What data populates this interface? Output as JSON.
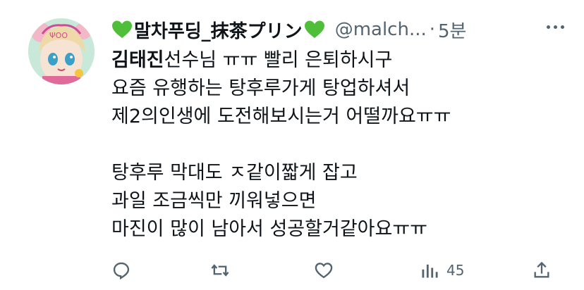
{
  "tweet": {
    "display_name": "말차푸딩_抹茶プリン",
    "handle": "@malch...",
    "separator": "·",
    "time": "5분",
    "lines": [
      {
        "mention": "김태진",
        "text": "선수님 ㅠㅠ 빨리 은퇴하시구"
      },
      {
        "mention": "",
        "text": "요즘 유행하는 탕후루가게 탕업하셔서"
      },
      {
        "mention": "",
        "text": "제2의인생에 도전해보시는거 어떨까요ㅠㅠ"
      },
      {
        "mention": "",
        "text": ""
      },
      {
        "mention": "",
        "text": "탕후루 막대도 ㅈ같이짧게 잡고"
      },
      {
        "mention": "",
        "text": "과일 조금씩만 끼워넣으면"
      },
      {
        "mention": "",
        "text": "마진이 많이 남아서 성공할거같아요ㅠㅠ"
      }
    ]
  },
  "actions": {
    "views_count": "45"
  },
  "icons": {
    "heart_emoji": "green-heart-icon",
    "reply": "reply-icon",
    "retweet": "retweet-icon",
    "like": "like-icon",
    "views": "views-icon",
    "share": "share-icon",
    "more": "more-icon"
  },
  "colors": {
    "heart_green": "#4fbf3a",
    "secondary_text": "#536471",
    "primary_text": "#0f1419"
  }
}
